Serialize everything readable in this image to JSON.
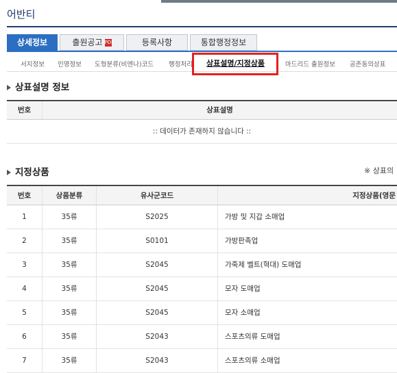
{
  "header": {
    "title": "어반티"
  },
  "tabs": [
    {
      "label": "상세정보",
      "active": true
    },
    {
      "label": "출원공고",
      "pdf_icon": "pdf-icon",
      "pdf_text": "PDF"
    },
    {
      "label": "등록사항"
    },
    {
      "label": "통합행정정보"
    }
  ],
  "subtabs": [
    "서지정보",
    "인명정보",
    "도형분류(비엔나)코드",
    "행정처리",
    "상표설명/지정상품",
    "마드리드 출원정보",
    "공존동의상표"
  ],
  "section1": {
    "title": "상표설명 정보",
    "columns": [
      "번호",
      "상표설명"
    ],
    "empty_message": ":: 데이터가 존재하지 않습니다 ::"
  },
  "section2": {
    "title": "지정상품",
    "note": "※ 상표의",
    "columns": [
      "번호",
      "상품분류",
      "유사군코드",
      "지정상품(영문"
    ],
    "rows": [
      [
        "1",
        "35류",
        "S2025",
        "가방 및 지갑 소매업"
      ],
      [
        "2",
        "35류",
        "S0101",
        "가방판촉업"
      ],
      [
        "3",
        "35류",
        "S2045",
        "가죽제 벨트(혁대) 도매업"
      ],
      [
        "4",
        "35류",
        "S2045",
        "모자 도매업"
      ],
      [
        "5",
        "35류",
        "S2045",
        "모자 소매업"
      ],
      [
        "6",
        "35류",
        "S2043",
        "스포츠의류 도매업"
      ],
      [
        "7",
        "35류",
        "S2043",
        "스포츠의류 소매업"
      ]
    ]
  },
  "colors": {
    "primary": "#2c6fc2",
    "title": "#1f3a6e",
    "highlight": "#e32020"
  }
}
